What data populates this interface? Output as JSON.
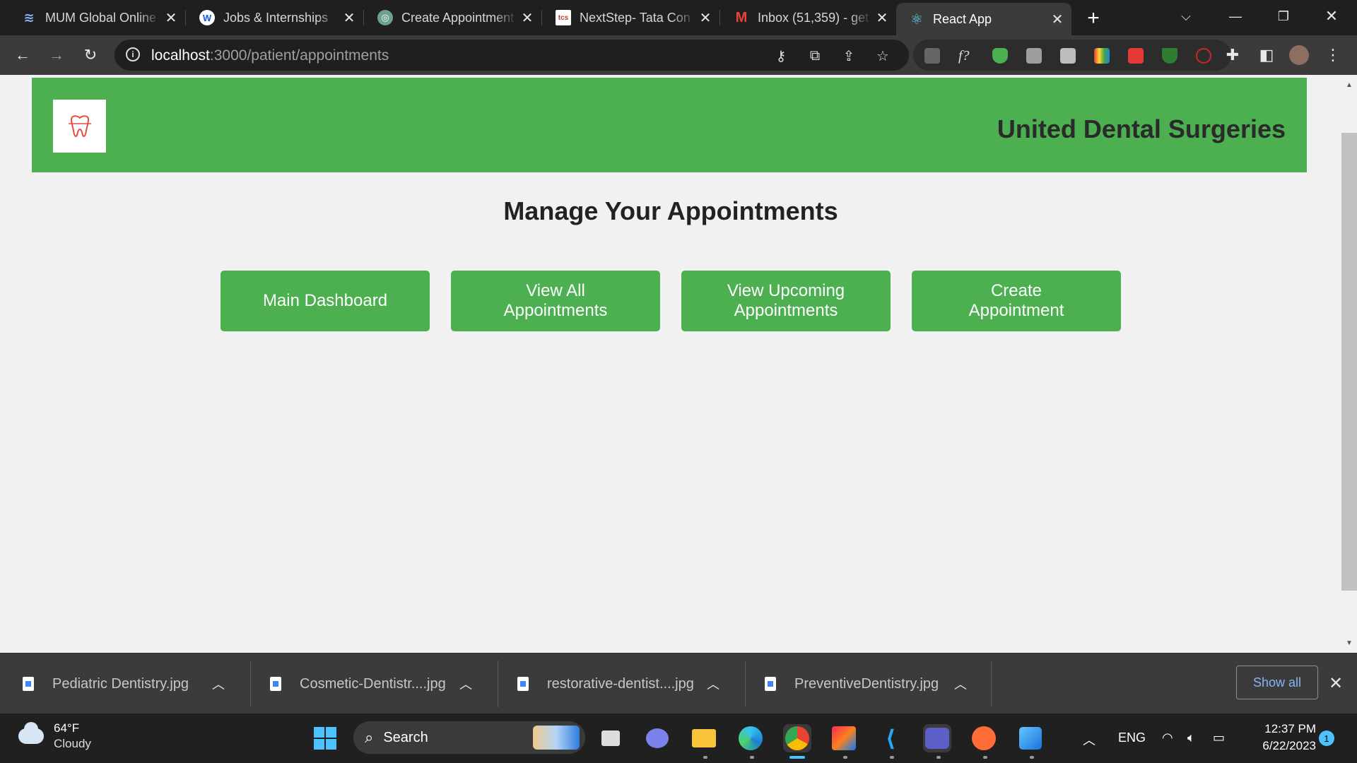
{
  "browser": {
    "tabs": [
      {
        "title": "MUM Global Online",
        "icon": "mum-icon"
      },
      {
        "title": "Jobs & Internships",
        "icon": "w-icon"
      },
      {
        "title": "Create Appointment",
        "icon": "chatgpt-icon"
      },
      {
        "title": "NextStep- Tata Con",
        "icon": "tcs-icon"
      },
      {
        "title": "Inbox (51,359) - get",
        "icon": "gmail-icon"
      },
      {
        "title": "React App",
        "icon": "react-icon"
      }
    ],
    "url_host": "localhost",
    "url_path": ":3000/patient/appointments"
  },
  "site": {
    "title": "United Dental Surgeries",
    "heading": "Manage Your Appointments",
    "buttons": {
      "main_dashboard": "Main Dashboard",
      "view_all": "View All Appointments",
      "view_upcoming": "View Upcoming Appointments",
      "create": "Create Appointment"
    },
    "colors": {
      "primary": "#4caf50",
      "logo": "#e74c3c"
    }
  },
  "downloads": {
    "files": [
      "Pediatric Dentistry.jpg",
      "Cosmetic-Dentistr....jpg",
      "restorative-dentist....jpg",
      "PreventiveDentistry.jpg"
    ],
    "show_all": "Show all"
  },
  "taskbar": {
    "temperature": "64°F",
    "condition": "Cloudy",
    "search": "Search",
    "language": "ENG",
    "time": "12:37 PM",
    "date": "6/22/2023",
    "notifications": "1"
  }
}
